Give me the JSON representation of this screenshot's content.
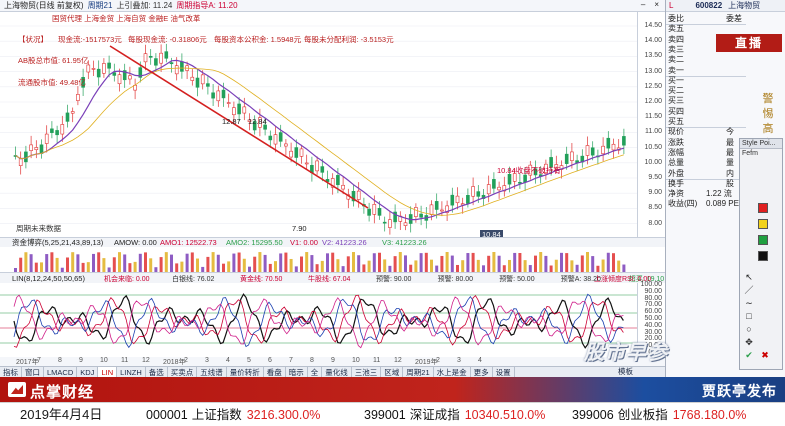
{
  "window": {
    "title": "上海物贸(日线 前复权)",
    "period_label": "周期21",
    "ratio_label": "上引叠加: 11.24",
    "hist_label": "周期指导A: 11.20"
  },
  "main_annotations": {
    "tags": "国贸代理  上海金贸  上海自贸  金融E  油气改革",
    "status_btn": "【状况】",
    "cash_flow": "现金流:-1517573元",
    "per_share_cash": "每股现金流: -0.31806元",
    "reserve": "每股资本公积金: 1.5948元",
    "undistributed": "每股未分配利润: -3.5153元",
    "float_cap": "AB股总市值: 61.95亿",
    "sh_cap": "流通股市值: 49.48亿",
    "price_high_label": "12.87",
    "price_high_label2": "12.84",
    "price_low_label": "7.90",
    "support_note": "10.84收盘不破持有",
    "weekly_note": "周期未来数据",
    "price_tag": "10.84"
  },
  "price_axis": [
    "14.50",
    "14.00",
    "13.50",
    "13.00",
    "12.50",
    "12.00",
    "11.50",
    "11.00",
    "10.50",
    "10.00",
    "9.50",
    "9.00",
    "8.50",
    "8.00"
  ],
  "volume_header": {
    "title": "资金博弈(5,25,21,43,89,13)",
    "amow": "AMOW: 0.00",
    "amo1": "AMO1: 12522.73",
    "amo2": "AMO2: 15295.50",
    "v1": "V1: 0.00",
    "v2": "V2: 41223.26",
    "v3": "V3: 41223.26"
  },
  "macd_header": {
    "title": "LIN(8,12,24,50,50,65)",
    "items": [
      "机会来临: 0.00",
      "白银线: 76.02",
      "黄金线: 70.50",
      "牛股线: 67.04",
      "预警: 90.00",
      "预警: 80.00",
      "预警: 50.00",
      "预警A: 38.20",
      "超买: 19.10",
      "超卖: 8.00"
    ],
    "rsi_label": "上涨倾度RSI: 0.00"
  },
  "macd_axis": [
    "100.00",
    "90.00",
    "80.00",
    "70.00",
    "60.00",
    "50.00",
    "40.00",
    "30.00",
    "20.00",
    "10.00",
    "0.00"
  ],
  "date_axis": [
    "2017年",
    "7",
    "8",
    "9",
    "10",
    "11",
    "12",
    "2018年",
    "2",
    "3",
    "4",
    "5",
    "6",
    "7",
    "8",
    "9",
    "10",
    "11",
    "12",
    "2019年",
    "2",
    "3",
    "4"
  ],
  "tabs": [
    "指标",
    "窗口",
    "LMACD",
    "KDJ",
    "LIN",
    "LINZH",
    "备选",
    "买卖点",
    "五线谱",
    "量价转折",
    "看盘",
    "暗示",
    "全",
    "量化线",
    "三池三",
    "区域",
    "周期21",
    "水上是金",
    "更多",
    "设置"
  ],
  "tab_active_index": 4,
  "tab_right": "模板",
  "quote": {
    "code": "600822",
    "name": "上海物贸",
    "rows": [
      {
        "label": "委比",
        "value": "委差"
      },
      {
        "label": "卖五",
        "value": ""
      },
      {
        "label": "卖四",
        "value": ""
      },
      {
        "label": "卖三",
        "value": ""
      },
      {
        "label": "卖二",
        "value": ""
      },
      {
        "label": "卖一",
        "value": ""
      },
      {
        "label": "买一",
        "value": ""
      },
      {
        "label": "买二",
        "value": ""
      },
      {
        "label": "买三",
        "value": ""
      },
      {
        "label": "买四",
        "value": ""
      },
      {
        "label": "买五",
        "value": ""
      },
      {
        "label": "现价",
        "value": "今"
      },
      {
        "label": "涨跌",
        "value": "最"
      },
      {
        "label": "涨幅",
        "value": "最"
      },
      {
        "label": "总量",
        "value": "量"
      },
      {
        "label": "外盘",
        "value": "内"
      },
      {
        "label": "换手",
        "value": "股"
      },
      {
        "label": "净资",
        "value": "1.22 流"
      },
      {
        "label": "收益(四)",
        "value": "0.089 PE"
      }
    ],
    "live_label": "直播",
    "live_prefix": "L"
  },
  "side_vertical_text": [
    "警",
    "惕",
    "高",
    "利",
    "诱",
    "饵",
    "过",
    "场",
    "正",
    "宗",
    "与",
    "资"
  ],
  "toolbox": {
    "title": "Style Poi...",
    "sub": "Fefm"
  },
  "watermark": "股市早参",
  "banner": {
    "brand": "点掌财经",
    "right_title": "贾跃亭发布"
  },
  "ticker": {
    "date": "2019年4月4日",
    "items": [
      {
        "code": "000001",
        "name": "上证指数",
        "value": "3216.30",
        "change": "0.0%"
      },
      {
        "code": "399001",
        "name": "深证成指",
        "value": "10340.51",
        "change": "0.0%"
      },
      {
        "code": "399006",
        "name": "创业板指",
        "value": "1768.18",
        "change": "0.0%"
      }
    ]
  },
  "colors": {
    "trendline": "#d42020",
    "candle_up": "#e03030",
    "candle_down": "#22a05a",
    "ma1": "#7a3fb8",
    "ma2": "#e0b020"
  }
}
